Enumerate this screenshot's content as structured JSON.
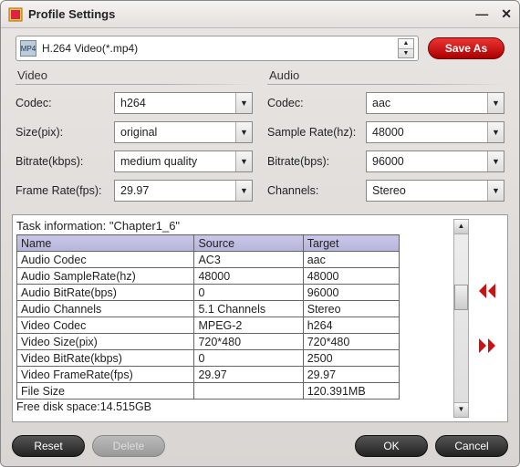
{
  "window": {
    "title": "Profile Settings"
  },
  "profile": {
    "selected": "H.264 Video(*.mp4)",
    "saveas": "Save As"
  },
  "video": {
    "title": "Video",
    "codec_label": "Codec:",
    "codec": "h264",
    "size_label": "Size(pix):",
    "size": "original",
    "bitrate_label": "Bitrate(kbps):",
    "bitrate": "medium quality",
    "fps_label": "Frame Rate(fps):",
    "fps": "29.97"
  },
  "audio": {
    "title": "Audio",
    "codec_label": "Codec:",
    "codec": "aac",
    "sr_label": "Sample Rate(hz):",
    "sr": "48000",
    "bitrate_label": "Bitrate(bps):",
    "bitrate": "96000",
    "channels_label": "Channels:",
    "channels": "Stereo"
  },
  "task": {
    "title": "Task information: \"Chapter1_6\"",
    "headers": [
      "Name",
      "Source",
      "Target"
    ],
    "rows": [
      [
        "Audio Codec",
        "AC3",
        "aac"
      ],
      [
        "Audio SampleRate(hz)",
        "48000",
        "48000"
      ],
      [
        "Audio BitRate(bps)",
        "0",
        "96000"
      ],
      [
        "Audio Channels",
        "5.1 Channels",
        "Stereo"
      ],
      [
        "Video Codec",
        "MPEG-2",
        "h264"
      ],
      [
        "Video Size(pix)",
        "720*480",
        "720*480"
      ],
      [
        "Video BitRate(kbps)",
        "0",
        "2500"
      ],
      [
        "Video FrameRate(fps)",
        "29.97",
        "29.97"
      ],
      [
        "File Size",
        "",
        "120.391MB"
      ]
    ],
    "freedisk": "Free disk space:14.515GB"
  },
  "footer": {
    "reset": "Reset",
    "delete": "Delete",
    "ok": "OK",
    "cancel": "Cancel"
  }
}
